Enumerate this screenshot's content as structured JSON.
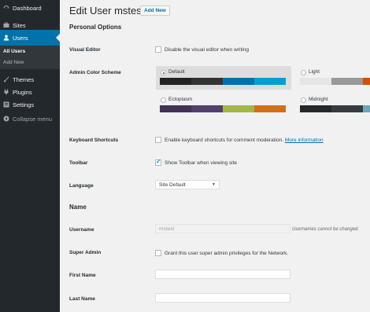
{
  "sidebar": {
    "items": [
      {
        "label": "Dashboard",
        "icon": "dashboard-icon"
      },
      {
        "label": "Sites",
        "icon": "sites-icon"
      },
      {
        "label": "Users",
        "icon": "users-icon"
      },
      {
        "label": "Themes",
        "icon": "themes-icon"
      },
      {
        "label": "Plugins",
        "icon": "plugins-icon"
      },
      {
        "label": "Settings",
        "icon": "settings-icon"
      },
      {
        "label": "Collapse menu",
        "icon": "collapse-icon"
      }
    ],
    "submenu": [
      "All Users",
      "Add New"
    ],
    "colors": {
      "bg": "#23282d",
      "active": "#0073aa",
      "submenu_bg": "#32373c"
    }
  },
  "header": {
    "title": "Edit User mstest",
    "add_new": "Add New"
  },
  "personal_options": {
    "title": "Personal Options",
    "visual_editor": {
      "label": "Visual Editor",
      "text": "Disable the visual editor when writing",
      "checked": false
    },
    "color_scheme": {
      "label": "Admin Color Scheme",
      "schemes": [
        {
          "name": "Default",
          "selected": true,
          "colors": [
            "#222222",
            "#333333",
            "#0073aa",
            "#00a0d2"
          ]
        },
        {
          "name": "Light",
          "selected": false,
          "colors": [
            "#e5e5e5",
            "#999999",
            "#d64e07",
            "#04a4cc"
          ]
        },
        {
          "name": "Ectoplasm",
          "selected": false,
          "colors": [
            "#413256",
            "#523f6d",
            "#a3b745",
            "#d46f15"
          ]
        },
        {
          "name": "Midnight",
          "selected": false,
          "colors": [
            "#25282b",
            "#363b3f",
            "#69a8bb",
            "#e14d43"
          ]
        }
      ]
    },
    "keyboard_shortcuts": {
      "label": "Keyboard Shortcuts",
      "text": "Enable keyboard shortcuts for comment moderation.",
      "link": "More information",
      "checked": false
    },
    "toolbar": {
      "label": "Toolbar",
      "text": "Show Toolbar when viewing site",
      "checked": true
    },
    "language": {
      "label": "Language",
      "value": "Site Default"
    }
  },
  "name_section": {
    "title": "Name",
    "username": {
      "label": "Username",
      "value": "mstest",
      "description": "Usernames cannot be changed."
    },
    "super_admin": {
      "label": "Super Admin",
      "text": "Grant this user super admin privileges for the Network.",
      "checked": false
    },
    "first_name": {
      "label": "First Name",
      "value": ""
    },
    "last_name": {
      "label": "Last Name",
      "value": ""
    }
  }
}
